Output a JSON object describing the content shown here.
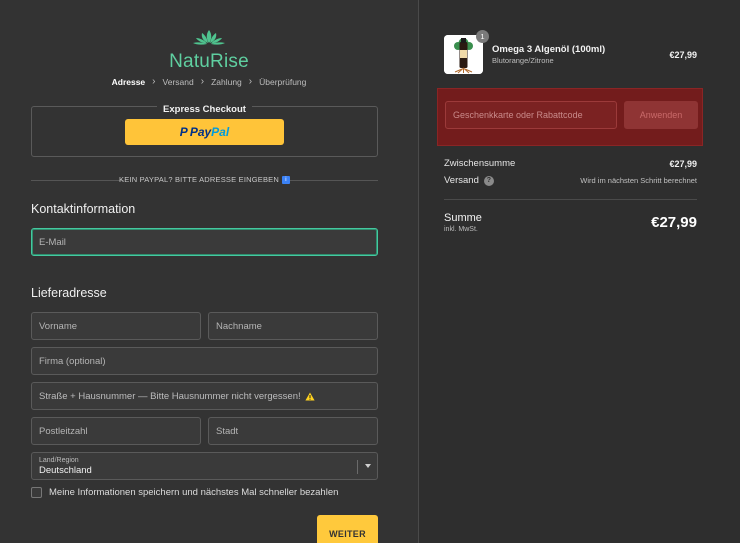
{
  "brand": {
    "name": "NatuRise",
    "color": "#5fcfa0"
  },
  "breadcrumb": [
    "Adresse",
    "Versand",
    "Zahlung",
    "Überprüfung"
  ],
  "express": {
    "title": "Express Checkout",
    "paypal_pay": "Pay",
    "paypal_pal": "Pal"
  },
  "separator": {
    "text": "KEIN PAYPAL? BITTE ADRESSE EINGEBEN",
    "icon": "info-icon"
  },
  "contact": {
    "title": "Kontaktinformation",
    "email_placeholder": "E-Mail"
  },
  "shipping": {
    "title": "Lieferadresse",
    "firstname_placeholder": "Vorname",
    "lastname_placeholder": "Nachname",
    "company_placeholder": "Firma (optional)",
    "street_placeholder": "Straße + Hausnummer — Bitte Hausnummer nicht vergessen!",
    "zip_placeholder": "Postleitzahl",
    "city_placeholder": "Stadt",
    "country_label": "Land/Region",
    "country_value": "Deutschland",
    "save_info_label": "Meine Informationen speichern und nächstes Mal schneller bezahlen"
  },
  "continue_button": "WEITER",
  "cart": {
    "item": {
      "name": "Omega 3 Algenöl (100ml)",
      "variant": "Blutorange/Zitrone",
      "price": "€27,99",
      "quantity": "1"
    },
    "discount": {
      "placeholder": "Geschenkkarte oder Rabattcode",
      "apply": "Anwenden",
      "highlight_color": "#731c1c"
    },
    "subtotal_label": "Zwischensumme",
    "subtotal_value": "€27,99",
    "shipping_label": "Versand",
    "shipping_value": "Wird im nächsten Schritt berechnet",
    "total_label": "Summe",
    "total_sub": "inkl. MwSt.",
    "total_value": "€27,99"
  },
  "colors": {
    "accent": "#ffc93c",
    "focus": "#45c9a0",
    "background": "#333333"
  }
}
